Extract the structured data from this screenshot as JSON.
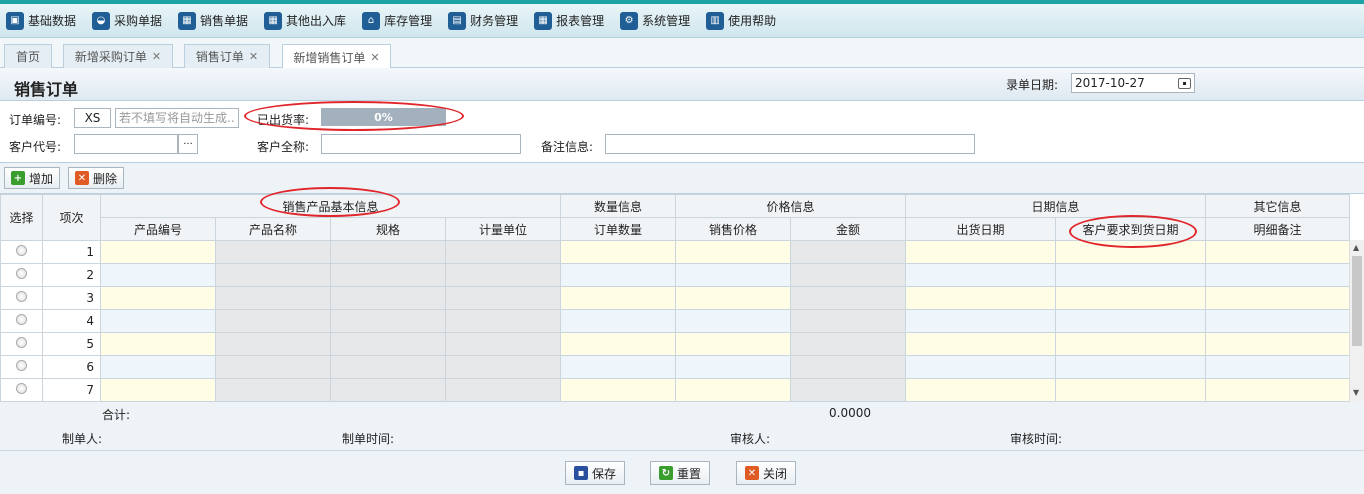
{
  "menu": [
    {
      "icon": "box-icon",
      "glyph": "▣",
      "label": "基础数据"
    },
    {
      "icon": "basket-icon",
      "glyph": "◒",
      "label": "采购单据"
    },
    {
      "icon": "calendar-icon",
      "glyph": "▦",
      "label": "销售单据"
    },
    {
      "icon": "calendar-icon",
      "glyph": "▦",
      "label": "其他出入库"
    },
    {
      "icon": "home-icon",
      "glyph": "⌂",
      "label": "库存管理"
    },
    {
      "icon": "finance-icon",
      "glyph": "▤",
      "label": "财务管理"
    },
    {
      "icon": "report-icon",
      "glyph": "▦",
      "label": "报表管理"
    },
    {
      "icon": "gear-icon",
      "glyph": "⚙",
      "label": "系统管理"
    },
    {
      "icon": "book-icon",
      "glyph": "▥",
      "label": "使用帮助"
    }
  ],
  "tabs": [
    {
      "label": "首页",
      "closable": false
    },
    {
      "label": "新增采购订单",
      "closable": true
    },
    {
      "label": "销售订单",
      "closable": true
    },
    {
      "label": "新增销售订单",
      "closable": true,
      "active": true
    }
  ],
  "page": {
    "title": "销售订单",
    "date_label": "录单日期:",
    "date_value": "2017-10-27"
  },
  "form": {
    "order_no_label": "订单编号:",
    "order_prefix": "XS",
    "order_placeholder": "若不填写将自动生成...",
    "shipped_label": "已出货率:",
    "shipped_rate": "0%",
    "customer_code_label": "客户代号:",
    "customer_name_label": "客户全称:",
    "remark_label": "备注信息:"
  },
  "toolbar": {
    "add_label": "增加",
    "delete_label": "删除"
  },
  "grid": {
    "select_header": "选择",
    "index_header": "项次",
    "groups": {
      "product": "销售产品基本信息",
      "quantity": "数量信息",
      "price": "价格信息",
      "date": "日期信息",
      "other": "其它信息"
    },
    "columns": [
      "产品编号",
      "产品名称",
      "规格",
      "计量单位",
      "订单数量",
      "销售价格",
      "金额",
      "出货日期",
      "客户要求到货日期",
      "明细备注"
    ],
    "rows": [
      1,
      2,
      3,
      4,
      5,
      6,
      7
    ],
    "total_label": "合计:",
    "total_value": "0.0000"
  },
  "footer": {
    "creator_label": "制单人:",
    "created_time_label": "制单时间:",
    "reviewer_label": "审核人:",
    "review_time_label": "审核时间:",
    "save_label": "保存",
    "reset_label": "重置",
    "close_label": "关闭"
  },
  "colors": {
    "accent": "#1ba3a6",
    "annotation": "#e0262b"
  }
}
